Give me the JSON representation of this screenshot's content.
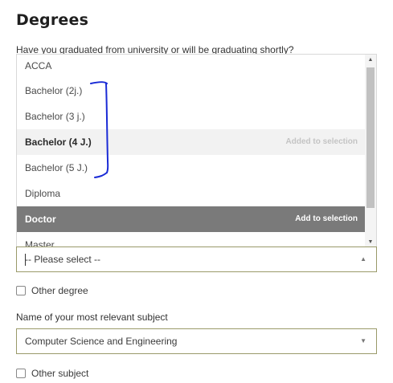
{
  "section": {
    "title": "Degrees"
  },
  "degree": {
    "question": "Have you graduated from university or will be graduating shortly?",
    "options": [
      {
        "label": "ACCA",
        "hint": ""
      },
      {
        "label": "Bachelor (2j.)",
        "hint": ""
      },
      {
        "label": "Bachelor (3 j.)",
        "hint": ""
      },
      {
        "label": "Bachelor (4 J.)",
        "hint": "Added to selection"
      },
      {
        "label": "Bachelor (5 J.)",
        "hint": ""
      },
      {
        "label": "Diploma",
        "hint": ""
      },
      {
        "label": "Doctor",
        "hint": "Add to selection"
      },
      {
        "label": "Master",
        "hint": ""
      }
    ],
    "select_value": "-- Please select --",
    "other_label": "Other degree"
  },
  "subject": {
    "label": "Name of your most relevant subject",
    "value": "Computer Science and Engineering",
    "other_label": "Other subject"
  },
  "colors": {
    "selected_row": "#f2f2f2",
    "highlighted_row": "#7a7a7a",
    "field_border": "#9a9a6a",
    "annotation_ink": "#1a2bd6"
  },
  "icons": {
    "scroll_up": "triangle-up",
    "scroll_down": "triangle-down",
    "select_caret": "caret-up",
    "subject_caret": "caret-down"
  }
}
